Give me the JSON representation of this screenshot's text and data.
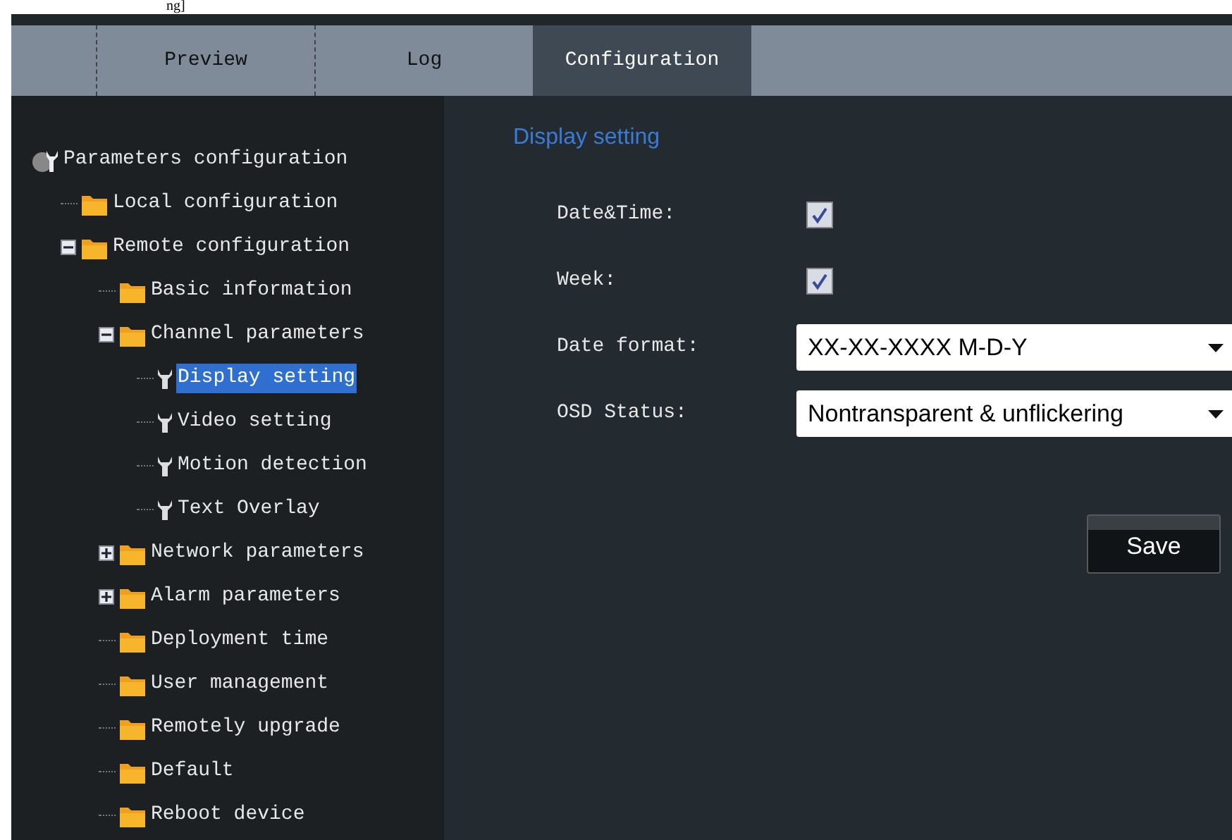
{
  "top_fragment": "ng]",
  "tabs": [
    {
      "label": "Preview",
      "selected": false
    },
    {
      "label": "Log",
      "selected": false
    },
    {
      "label": "Configuration",
      "selected": true
    }
  ],
  "tree": {
    "label": "Parameters configuration",
    "kind": "root",
    "selected": false,
    "children": [
      {
        "label": "Local configuration",
        "kind": "folder",
        "selected": false
      },
      {
        "label": "Remote configuration",
        "kind": "folder",
        "selected": false,
        "expanded": true,
        "children": [
          {
            "label": "Basic information",
            "kind": "folder",
            "selected": false
          },
          {
            "label": "Channel parameters",
            "kind": "folder",
            "selected": false,
            "expanded": true,
            "children": [
              {
                "label": "Display setting",
                "kind": "wrench",
                "selected": true
              },
              {
                "label": "Video setting",
                "kind": "wrench",
                "selected": false
              },
              {
                "label": "Motion detection",
                "kind": "wrench",
                "selected": false
              },
              {
                "label": "Text Overlay",
                "kind": "wrench",
                "selected": false
              }
            ]
          },
          {
            "label": "Network parameters",
            "kind": "folder",
            "selected": false,
            "expanded": false
          },
          {
            "label": "Alarm parameters",
            "kind": "folder",
            "selected": false,
            "expanded": false
          },
          {
            "label": "Deployment time",
            "kind": "folder",
            "selected": false
          },
          {
            "label": "User management",
            "kind": "folder",
            "selected": false
          },
          {
            "label": "Remotely upgrade",
            "kind": "folder",
            "selected": false
          },
          {
            "label": "Default",
            "kind": "folder",
            "selected": false
          },
          {
            "label": "Reboot device",
            "kind": "folder",
            "selected": false
          }
        ]
      }
    ]
  },
  "panel": {
    "title": "Display setting",
    "fields": [
      {
        "kind": "checkbox",
        "label": "Date&Time:",
        "checked": true
      },
      {
        "kind": "checkbox",
        "label": "Week:",
        "checked": true
      },
      {
        "kind": "select",
        "label": "Date format:",
        "value": "XX-XX-XXXX M-D-Y"
      },
      {
        "kind": "select",
        "label": "OSD Status:",
        "value": "Nontransparent & unflickering"
      }
    ],
    "save_button": "Save"
  }
}
